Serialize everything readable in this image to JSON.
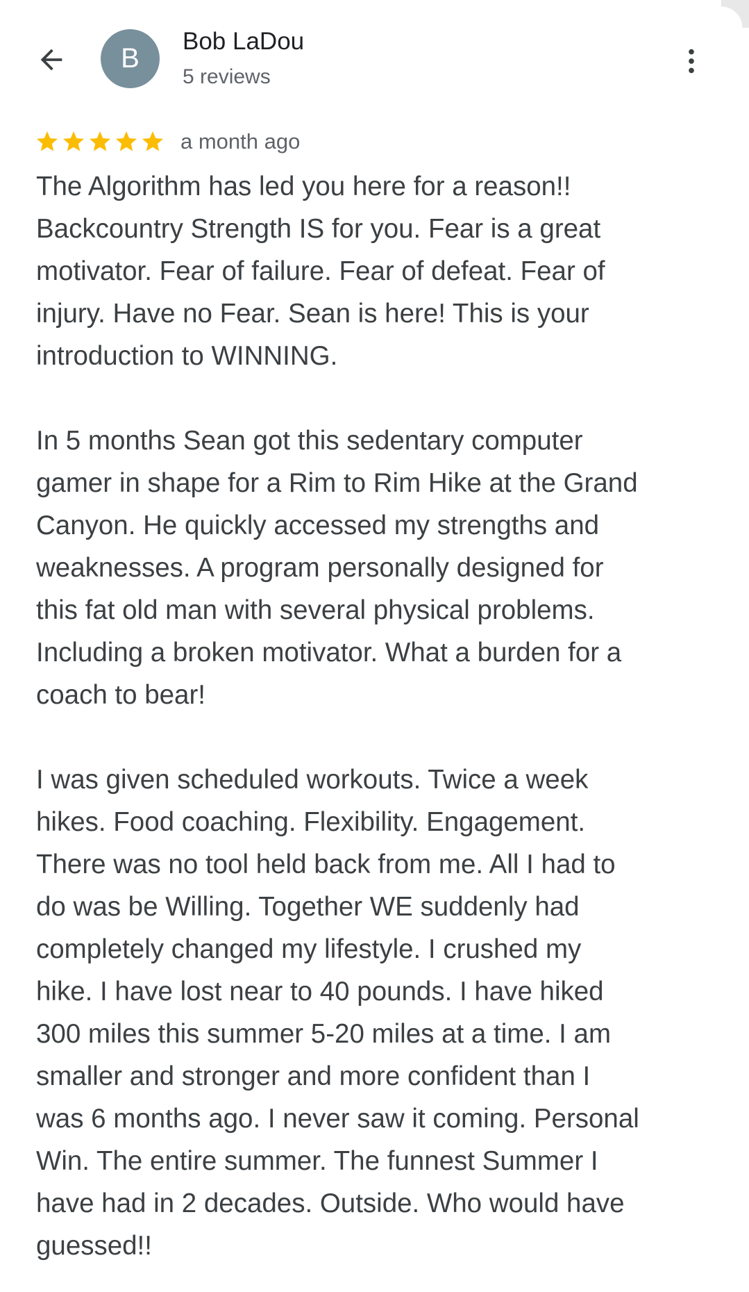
{
  "reviewer": {
    "avatar_letter": "B",
    "avatar_color": "#78909c",
    "name": "Bob LaDou",
    "review_count": "5 reviews"
  },
  "icons": {
    "back": "arrow-back-icon",
    "more": "more-vert-icon",
    "star": "star-icon"
  },
  "review": {
    "rating": 5,
    "rating_max": 5,
    "star_color": "#fbbc04",
    "date": "a month ago",
    "paragraphs": [
      {
        "lines": [
          "The Algorithm has led you here for a reason!!",
          "Backcountry Strength IS for you. Fear is a great",
          "motivator. Fear of failure. Fear of defeat. Fear of",
          "injury. Have no Fear. Sean is here! This is your",
          "introduction to WINNING."
        ]
      },
      {
        "lines": [
          "In 5 months Sean got this sedentary computer",
          "gamer in shape for a Rim to Rim Hike at the Grand",
          "Canyon. He quickly accessed my strengths and",
          "weaknesses. A program personally designed for",
          "this fat old man with several physical problems.",
          "Including a broken motivator. What a burden for a",
          "coach to bear!"
        ]
      },
      {
        "lines": [
          "I was given scheduled workouts. Twice a week",
          "hikes. Food coaching. Flexibility. Engagement.",
          "There was no tool held back from me. All I had to",
          "do was be Willing. Together WE suddenly had",
          "completely changed my lifestyle. I crushed my",
          "hike. I have lost near to 40 pounds. I have hiked",
          "300 miles this summer 5-20 miles at a time. I am",
          "smaller and stronger and more confident than I",
          "was 6 months ago. I never saw it coming. Personal",
          "Win. The entire summer. The funnest Summer I",
          "have had in 2 decades. Outside. Who would have",
          "guessed!!"
        ]
      }
    ]
  }
}
